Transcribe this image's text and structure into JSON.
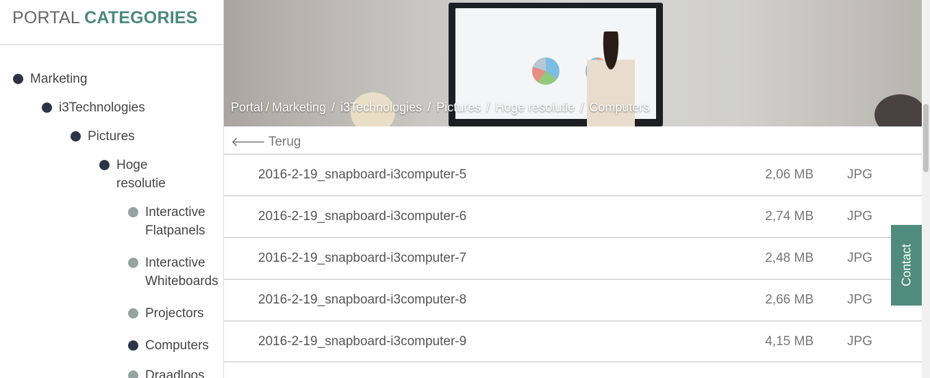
{
  "sidebar": {
    "title_prefix": "PORTAL",
    "title_accent": "CATEGORIES",
    "items": [
      {
        "label": "Marketing"
      },
      {
        "label": "i3Technologies"
      },
      {
        "label": "Pictures"
      },
      {
        "label": "Hoge",
        "label2": "resolutie"
      },
      {
        "label": "Interactive",
        "label2": "Flatpanels"
      },
      {
        "label": "Interactive",
        "label2": "Whiteboards"
      },
      {
        "label": "Projectors"
      },
      {
        "label": "Computers"
      },
      {
        "label": "Draadloos"
      }
    ]
  },
  "breadcrumb": {
    "items": [
      "Portal",
      "Marketing",
      "i3Technologies",
      "Pictures",
      "Hoge resolutie",
      "Computers"
    ],
    "separator": "/"
  },
  "back_link": {
    "label": "Terug"
  },
  "files": [
    {
      "name": "2016-2-19_snapboard-i3computer-5",
      "size": "2,06 MB",
      "type": "JPG"
    },
    {
      "name": "2016-2-19_snapboard-i3computer-6",
      "size": "2,74 MB",
      "type": "JPG"
    },
    {
      "name": "2016-2-19_snapboard-i3computer-7",
      "size": "2,48 MB",
      "type": "JPG"
    },
    {
      "name": "2016-2-19_snapboard-i3computer-8",
      "size": "2,66 MB",
      "type": "JPG"
    },
    {
      "name": "2016-2-19_snapboard-i3computer-9",
      "size": "4,15 MB",
      "type": "JPG"
    }
  ],
  "contact": {
    "label": "Contact"
  },
  "colors": {
    "accent": "#4a8a7a",
    "contact_bg": "#4f8c7d",
    "dot_dark": "#2d3447",
    "dot_grey": "#96a3a0"
  },
  "icons": {
    "back": "arrow-left-icon",
    "bullet_active": "bullet-dark-icon",
    "bullet_inactive": "bullet-grey-icon"
  }
}
